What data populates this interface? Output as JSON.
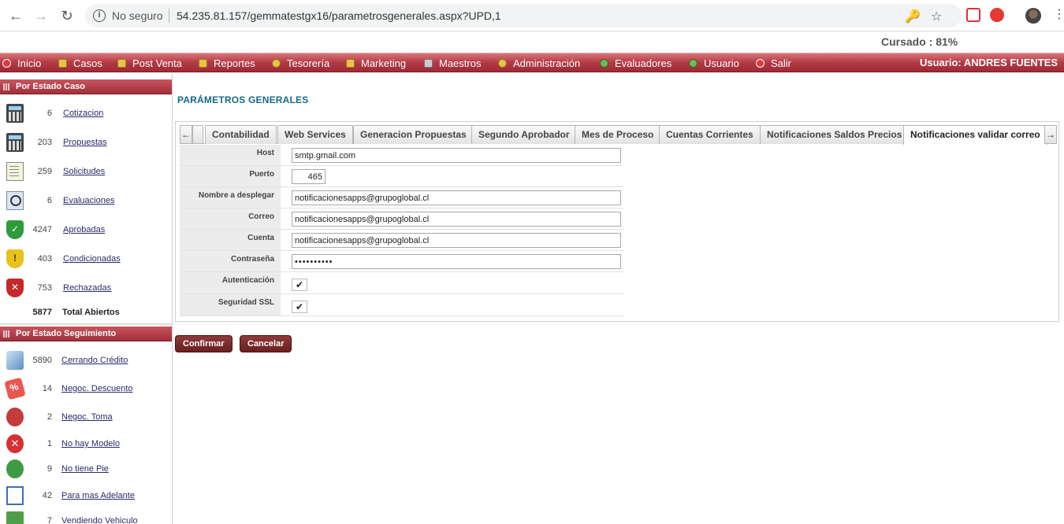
{
  "browser": {
    "security_label": "No seguro",
    "url": "54.235.81.157/gemmatestgx16/parametrosgenerales.aspx?UPD,1"
  },
  "header": {
    "progress_label": "Cursado : 81%"
  },
  "menu": {
    "items": [
      "Inicio",
      "Casos",
      "Post Venta",
      "Reportes",
      "Tesorería",
      "Marketing",
      "Maestros",
      "Administración",
      "Evaluadores",
      "Usuario",
      "Salir"
    ],
    "user_label": "Usuario:  ANDRES FUENTES"
  },
  "sidebar": {
    "estado_caso": {
      "title": "Por Estado Caso",
      "rows": [
        {
          "count": "6",
          "label": "Cotizacion",
          "icon": "calculator-icon"
        },
        {
          "count": "203",
          "label": "Propuestas",
          "icon": "calculator-icon"
        },
        {
          "count": "259",
          "label": "Solicitudes",
          "icon": "document-icon"
        },
        {
          "count": "6",
          "label": "Evaluaciones",
          "icon": "magnifier-icon"
        },
        {
          "count": "4247",
          "label": "Aprobadas",
          "icon": "green-shield-icon"
        },
        {
          "count": "403",
          "label": "Condicionadas",
          "icon": "yellow-shield-icon"
        },
        {
          "count": "753",
          "label": "Rechazadas",
          "icon": "red-shield-icon"
        }
      ],
      "total_count": "5877",
      "total_label": "Total Abiertos"
    },
    "estado_seguimiento": {
      "title": "Por Estado Seguimiento",
      "rows": [
        {
          "count": "5890",
          "label": "Cerrando Crédito",
          "icon": "pen-icon"
        },
        {
          "count": "14",
          "label": "Negoc. Descuento",
          "icon": "discount-tag-icon"
        },
        {
          "count": "2",
          "label": "Negoc. Toma",
          "icon": "speedometer-icon"
        },
        {
          "count": "1",
          "label": "No hay Modelo",
          "icon": "red-x-icon"
        },
        {
          "count": "9",
          "label": "No tiene Pie",
          "icon": "coins-icon"
        },
        {
          "count": "42",
          "label": "Para mas Adelante",
          "icon": "calendar-icon"
        },
        {
          "count": "7",
          "label": "Vendiendo Vehiculo",
          "icon": "money-icon"
        }
      ]
    }
  },
  "main": {
    "title": "PARÁMETROS GENERALES",
    "tabs": [
      "Contabilidad",
      "Web Services",
      "Generacion Propuestas",
      "Segundo Aprobador",
      "Mes de Proceso",
      "Cuentas Corrientes",
      "Notificaciones Saldos Precios",
      "Notificaciones validar correo"
    ],
    "active_tab": "Notificaciones validar correo",
    "form": {
      "host_label": "Host",
      "host_value": "smtp.gmail.com",
      "puerto_label": "Puerto",
      "puerto_value": "465",
      "nombre_label": "Nombre a desplegar",
      "nombre_value": "notificacionesapps@grupoglobal.cl",
      "correo_label": "Correo",
      "correo_value": "notificacionesapps@grupoglobal.cl",
      "cuenta_label": "Cuenta",
      "cuenta_value": "notificacionesapps@grupoglobal.cl",
      "contrasena_label": "Contraseña",
      "contrasena_value": "••••••••••",
      "autenticacion_label": "Autenticación",
      "autenticacion_checked": true,
      "ssl_label": "Seguridad SSL",
      "ssl_checked": true
    },
    "buttons": {
      "confirm": "Confirmar",
      "cancel": "Cancelar"
    }
  },
  "colors": {
    "menu_bar": "#b23a45",
    "title_teal": "#176a8a",
    "button": "#7a2a2a"
  }
}
